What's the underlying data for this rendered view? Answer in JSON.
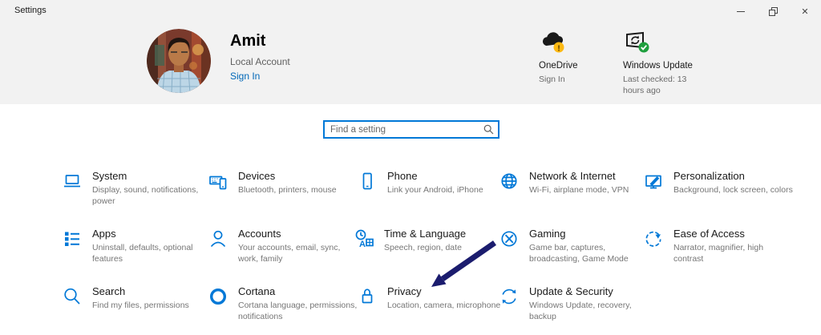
{
  "window": {
    "title": "Settings",
    "controls": {
      "minimize": "minimize-line",
      "restore": "overlapping-squares",
      "close_glyph": "✕"
    }
  },
  "hero": {
    "user": {
      "name": "Amit",
      "account_type": "Local Account",
      "sign_in": "Sign In"
    },
    "onedrive": {
      "title": "OneDrive",
      "status": "Sign In",
      "badge": "warning-exclamation",
      "badge_color": "#fdb913"
    },
    "windows_update": {
      "title": "Windows Update",
      "status": "Last checked: 13 hours ago",
      "badge": "check",
      "badge_color": "#1f9f3e"
    }
  },
  "search": {
    "placeholder": "Find a setting"
  },
  "tiles": [
    {
      "title": "System",
      "subtitle": "Display, sound, notifications, power",
      "icon": "laptop-icon"
    },
    {
      "title": "Devices",
      "subtitle": "Bluetooth, printers, mouse",
      "icon": "keyboard-phone-icon"
    },
    {
      "title": "Phone",
      "subtitle": "Link your Android, iPhone",
      "icon": "smartphone-icon"
    },
    {
      "title": "Network & Internet",
      "subtitle": "Wi-Fi, airplane mode, VPN",
      "icon": "globe-icon"
    },
    {
      "title": "Personalization",
      "subtitle": "Background, lock screen, colors",
      "icon": "monitor-brush-icon"
    },
    {
      "title": "Apps",
      "subtitle": "Uninstall, defaults, optional features",
      "icon": "app-list-icon"
    },
    {
      "title": "Accounts",
      "subtitle": "Your accounts, email, sync, work, family",
      "icon": "person-icon"
    },
    {
      "title": "Time & Language",
      "subtitle": "Speech, region, date",
      "icon": "clock-language-icon"
    },
    {
      "title": "Gaming",
      "subtitle": "Game bar, captures, broadcasting, Game Mode",
      "icon": "xbox-icon"
    },
    {
      "title": "Ease of Access",
      "subtitle": "Narrator, magnifier, high contrast",
      "icon": "ease-of-access-icon"
    },
    {
      "title": "Search",
      "subtitle": "Find my files, permissions",
      "icon": "magnifier-icon"
    },
    {
      "title": "Cortana",
      "subtitle": "Cortana language, permissions, notifications",
      "icon": "cortana-ring-icon"
    },
    {
      "title": "Privacy",
      "subtitle": "Location, camera, microphone",
      "icon": "lock-icon"
    },
    {
      "title": "Update & Security",
      "subtitle": "Windows Update, recovery, backup",
      "icon": "refresh-arrows-icon"
    }
  ],
  "annotation": {
    "type": "arrow",
    "points_to": "Privacy",
    "color": "#1b1c6e"
  },
  "colors": {
    "accent": "#0078d7",
    "link": "#0067b8",
    "hero_bg": "#f2f2f2",
    "subtitle_gray": "#767676"
  }
}
